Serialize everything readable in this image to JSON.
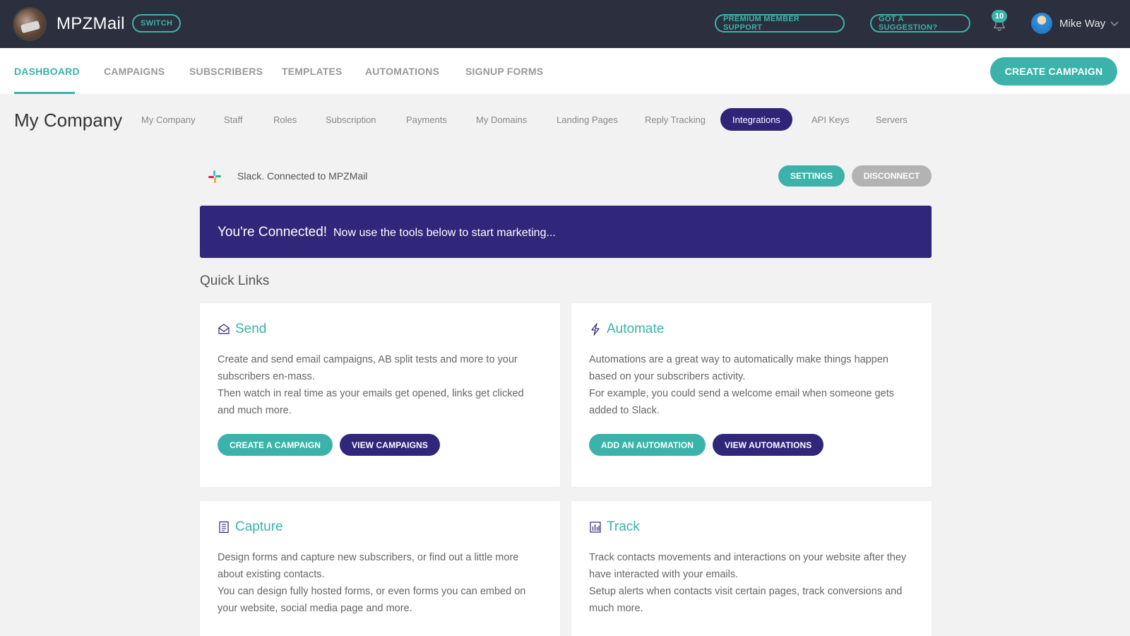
{
  "app": {
    "brand": "MPZMail",
    "switch_label": "SWITCH",
    "support_label": "PREMIUM MEMBER SUPPORT",
    "suggest_label": "GOT A SUGGESTION?",
    "notifications_count": "10",
    "user_name": "Mike Way"
  },
  "mainnav": {
    "items": [
      {
        "label": "DASHBOARD"
      },
      {
        "label": "CAMPAIGNS"
      },
      {
        "label": "SUBSCRIBERS"
      },
      {
        "label": "TEMPLATES"
      },
      {
        "label": "AUTOMATIONS"
      },
      {
        "label": "SIGNUP FORMS"
      }
    ],
    "active": "DASHBOARD",
    "create_label": "CREATE CAMPAIGN"
  },
  "subnav": {
    "page_title": "My Company",
    "items": [
      {
        "label": "My Company"
      },
      {
        "label": "Staff"
      },
      {
        "label": "Roles"
      },
      {
        "label": "Subscription"
      },
      {
        "label": "Payments"
      },
      {
        "label": "My Domains"
      },
      {
        "label": "Landing Pages"
      },
      {
        "label": "Reply Tracking"
      },
      {
        "label": "Integrations"
      },
      {
        "label": "API Keys"
      },
      {
        "label": "Servers"
      }
    ],
    "active": "Integrations"
  },
  "integration": {
    "status_text": "Slack. Connected to MPZMail",
    "settings_label": "SETTINGS",
    "disconnect_label": "DISCONNECT"
  },
  "banner": {
    "title": "You're Connected!",
    "subtitle": "Now use the tools below to start marketing..."
  },
  "quick_links": {
    "title": "Quick Links",
    "cards": [
      {
        "icon": "envelope-icon",
        "title": "Send",
        "lines": [
          "Create and send email campaigns, AB split tests and more to your",
          "subscribers en-mass.",
          "Then watch in real time as your emails get opened, links get clicked",
          "and much more."
        ],
        "buttons": [
          {
            "label": "CREATE A CAMPAIGN"
          },
          {
            "label": "VIEW CAMPAIGNS"
          }
        ]
      },
      {
        "icon": "lightning-icon",
        "title": "Automate",
        "lines": [
          "Automations are a great way to automatically make things happen",
          "based on your subscribers activity.",
          "For example, you could send a welcome email when someone gets",
          "added to Slack."
        ],
        "buttons": [
          {
            "label": "ADD AN AUTOMATION"
          },
          {
            "label": "VIEW AUTOMATIONS"
          }
        ]
      },
      {
        "icon": "form-icon",
        "title": "Capture",
        "lines": [
          "Design forms and capture new subscribers, or find out a little more",
          "about existing contacts.",
          "You can design fully hosted forms, or even forms you can embed on",
          "your website, social media page and more."
        ]
      },
      {
        "icon": "bar-chart-icon",
        "title": "Track",
        "lines": [
          "Track contacts movements and interactions on your website after they",
          "have interacted with your emails.",
          "Setup alerts when contacts visit certain pages, track conversions and",
          "much more."
        ]
      }
    ]
  },
  "colors": {
    "topbar": "#2b2f3e",
    "teal": "#3bb3aa",
    "navy": "#30267a",
    "background": "#f2f2f2"
  }
}
